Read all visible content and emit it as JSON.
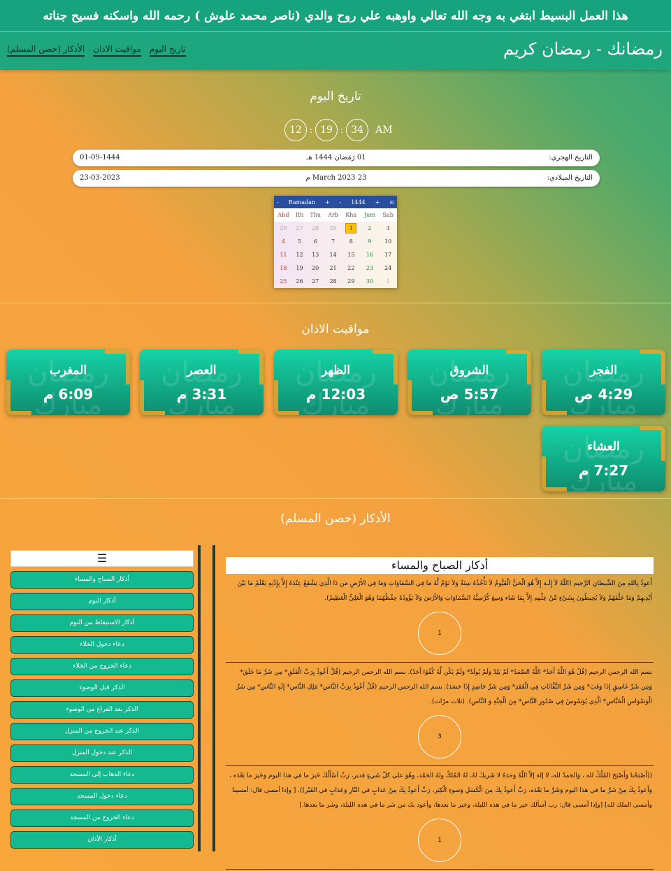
{
  "banner": "هذا العمل البسيط ابتغي به وجه الله تعالي واوهبه علي روح والدي (ناصر محمد علوش ) رحمه الله واسكنه فسيح جناته",
  "nav": {
    "brand": "رمضانك - رمضان كريم",
    "links": [
      "تاريخ اليوم",
      "مواقيت الاذان",
      "الأذكار (حصن المسلم)"
    ]
  },
  "today": {
    "title": "تاريخ اليوم",
    "clock": {
      "h": "12",
      "m": "19",
      "s": "34",
      "ampm": "AM"
    },
    "hijri": {
      "label": "التاريخ الهجري:",
      "text": "01 رَمَضان 1444 هـ",
      "num": "01-09-1444"
    },
    "gregorian": {
      "label": "التاريخ الميلادي:",
      "text": "23 March 2023 م",
      "num": "23-03-2023"
    }
  },
  "calendar": {
    "prev_month": "-",
    "month": "Ramadan",
    "next_month": "+",
    "prev_year": "-",
    "year": "1444",
    "next_year": "+",
    "settings_icon": "⊙",
    "weekdays": [
      "Ahd",
      "Ith",
      "Thu",
      "Arb",
      "Kha",
      "Jum",
      "Sab"
    ],
    "weeks": [
      [
        "26",
        "27",
        "28",
        "29",
        "1",
        "2",
        "3"
      ],
      [
        "4",
        "5",
        "6",
        "7",
        "8",
        "9",
        "10"
      ],
      [
        "11",
        "12",
        "13",
        "14",
        "15",
        "16",
        "17"
      ],
      [
        "18",
        "19",
        "20",
        "21",
        "22",
        "23",
        "24"
      ],
      [
        "25",
        "26",
        "27",
        "28",
        "29",
        "30",
        "1"
      ]
    ],
    "today": "1"
  },
  "prayers": {
    "title": "مواقيت الاذان",
    "deco": "رمضان مبارك",
    "items": [
      {
        "name": "الفجر",
        "time": "4:29 ص"
      },
      {
        "name": "الشروق",
        "time": "5:57 ص"
      },
      {
        "name": "الظهر",
        "time": "12:03 م"
      },
      {
        "name": "العصر",
        "time": "3:31 م"
      },
      {
        "name": "المغرب",
        "time": "6:09 م"
      },
      {
        "name": "العشاء",
        "time": "7:27 م"
      }
    ]
  },
  "adhkar": {
    "title": "الأذكار (حصن المسلم)",
    "menu_icon": "☰",
    "menu": [
      "أذكار الصباح والمساء",
      "أذكار النوم",
      "أذكار الاستيقاظ من النوم",
      "دعاء دخول الخلاء",
      "دعاء الخروج من الخلاء",
      "الذكر قبل الوضوء",
      "الذكر بعد الفراغ من الوضوء",
      "الذكر عند الخروج من المنزل",
      "الذكر عند دخول المنزل",
      "دعاء الذهاب إلى المسجد",
      "دعاء دخول المسجد",
      "دعاء الخروج من المسجد",
      "أذكار الآذان"
    ],
    "section_title": "أذكار الصباح والمساء",
    "items": [
      {
        "text": "أَعوذُ بِاللهِ مِنَ الشَّيطانِ الرَّجيم (اللّهُ لاَ إِلَـهَ إِلاَّ هُوَ الْحَيُّ الْقَيُّومُ لاَ تَأْخُذُهُ سِنَةٌ وَلاَ نَوْمٌ لَّهُ مَا فِي السَّمَاوَاتِ وَمَا فِي الأَرْضِ مَن ذَا الَّذِي يَشْفَعُ عِنْدَهُ إِلاَّ بِإِذْنِهِ يَعْلَمُ مَا بَيْنَ أَيْدِيهِمْ وَمَا خَلْفَهُمْ وَلاَ يُحِيطُونَ بِشَيْءٍ مِّنْ عِلْمِهِ إِلاَّ بِمَا شَاء وَسِعَ كُرْسِيُّهُ السَّمَاوَاتِ وَالأَرْضَ وَلاَ يَؤُودُهُ حِفْظُهُمَا وَهُوَ الْعَلِيُّ الْعَظِيمُ).",
        "count": "1"
      },
      {
        "text": "بسم الله الرحمن الرحيم (قُلْ هُوَ اللَّهُ أَحَدٌ* اللَّهُ الصَّمَدُ* لَمْ يَلِدْ وَلَمْ يُولَدْ* وَلَمْ يَكُن لَّهُ كُفُوًا أَحَدٌ). بسم الله الرحمن الرحيم (قُلْ أَعُوذُ بِرَبِّ الْفَلَقِ* مِن شَرِّ مَا خَلَقَ* وَمِن شَرِّ غَاسِقٍ إِذَا وَقَبَ* وَمِن شَرِّ النَّفَّاثَاتِ فِي الْعُقَدِ* وَمِن شَرِّ حَاسِدٍ إِذَا حَسَدَ). بسم الله الرحمن الرحيم (قُلْ أَعُوذُ بِرَبِّ النَّاسِ* مَلِكِ النَّاسِ* إِلَهِ النَّاسِ* مِن شَرِّ الْوَسْوَاسِ الْخَنَّاسِ* الَّذِي يُوَسْوِسُ فِي صُدُورِ النَّاسِ* مِنَ الْجِنَّةِ وَ النَّاسِ). (ثلاث مرّات).",
        "count": "3"
      },
      {
        "text": "((أَصْبَحْنا وَأَصْبَحَ المُلْكُ لله ، وَالحَمدُ لله، لا إلهَ إلاّ اللّهُ وَحدَهُ لا شَريكَ لهُ، لهُ المُلكُ ولهُ الحَمْد، وهُوَ على كلّ شَيءٍ قدير، رَبِّ أسْأَلُكَ خَيرَ ما في هذا اليوم وَخَيرَ ما بَعْدَه ، وَأَعوذُ بِكَ مِنْ شَرِّ ما في هذا اليوم وَشَرِّ ما بَعْدَه، رَبِّ أَعوذُ بِكَ مِنَ الْكَسَلِ وَسوءِ الْكِبَر، رَبِّ أَعوذُ بِكَ مِنْ عَذابٍ في النّارِ وَعَذابٍ في القَبْر)). [ وإذا أمسى قال: أمسينا وأمسى الملك لله] [وإذا أمسى قال: رب أسألك خير ما في هذه الليلة، وخير ما بعدها، وأعوذ بك من شر ما في هذه الليلة، وشر ما بعدها.]",
        "count": "1"
      }
    ]
  }
}
